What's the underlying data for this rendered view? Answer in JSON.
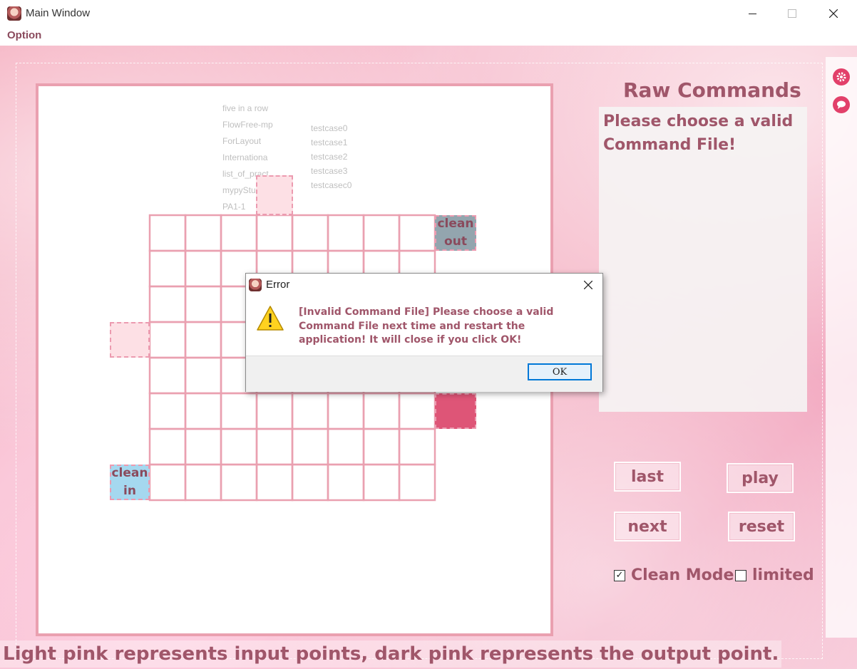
{
  "window": {
    "title": "Main Window"
  },
  "menu": {
    "option_label": "Option"
  },
  "grid": {
    "clean_out_label": "clean out",
    "clean_in_label": "clean in",
    "ghost_items": [
      "five in a row",
      "FlowFree-mp",
      "ForLayout",
      "Internationa",
      "list_of_pract",
      "mypyStu",
      "PA1-1",
      "testcase0",
      "testcase1",
      "testcase2",
      "testcase3",
      "testcasec0"
    ]
  },
  "panel": {
    "title": "Raw Commands",
    "message": "Please choose a valid Command File!",
    "buttons": {
      "last": "last",
      "play": "play",
      "next": "next",
      "reset": "reset"
    },
    "clean_mode_label": "Clean Mode",
    "clean_mode_checked": true,
    "limited_label": "limited",
    "limited_checked": false
  },
  "status_text": "Light pink represents input points, dark pink represents the output point.",
  "dialog": {
    "title": "Error",
    "message": "[Invalid Command File] Please choose a valid Command File next time and restart the application! It will close if you click OK!",
    "ok_label": "OK"
  },
  "colors": {
    "text_accent": "#a0566a",
    "grid_line": "#eaa0b0",
    "input_point": "#fde0e5",
    "output_point": "#de5577",
    "clean_out": "#93a5ae",
    "clean_in": "#a5d8ef"
  },
  "icons": [
    "app-icon",
    "gear-icon",
    "chat-icon",
    "warning-icon",
    "close-icon"
  ]
}
